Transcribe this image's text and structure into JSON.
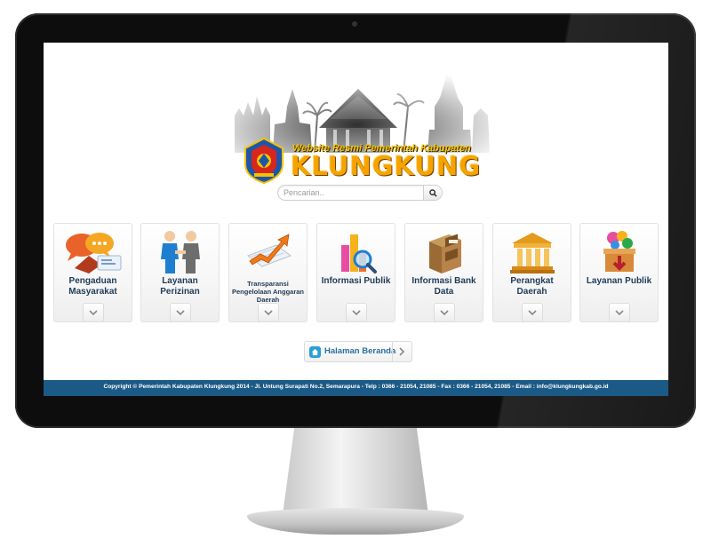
{
  "header": {
    "tagline": "Website Resmi Pemerintah Kabupaten",
    "brand": "KLUNGKUNG"
  },
  "search": {
    "placeholder": "Pencarian..",
    "button_icon": "search-icon"
  },
  "cards": [
    {
      "label": "Pengaduan Masyarakat",
      "icon": "chat-bubbles-icon"
    },
    {
      "label": "Layanan Perizinan",
      "icon": "handshake-people-icon"
    },
    {
      "label": "Transparansi Pengelolaan Anggaran Daerah",
      "icon": "rising-chart-icon"
    },
    {
      "label": "Informasi Publik",
      "icon": "bar-chart-magnifier-icon"
    },
    {
      "label": "Informasi Bank Data",
      "icon": "file-cabinet-icon"
    },
    {
      "label": "Perangkat Daerah",
      "icon": "government-building-icon"
    },
    {
      "label": "Layanan Publik",
      "icon": "gift-box-icon"
    }
  ],
  "home_link": {
    "label": "Halaman Beranda",
    "icon": "home-icon",
    "arrow_icon": "chevron-right-icon"
  },
  "footer": {
    "text": "Copyright © Pemerintah Kabupaten Klungkung 2014 - Jl. Untung Surapati No.2, Semarapura - Telp : 0366 - 21054, 21085 - Fax : 0366 - 21054, 21085 - Email : info@klungkungkab.go.id"
  },
  "colors": {
    "footer_bg": "#1b5a86",
    "brand_orange": "#f6a300",
    "tagline_yellow": "#f2c400",
    "card_label": "#1f3b57",
    "link_blue": "#2a6f9e"
  }
}
